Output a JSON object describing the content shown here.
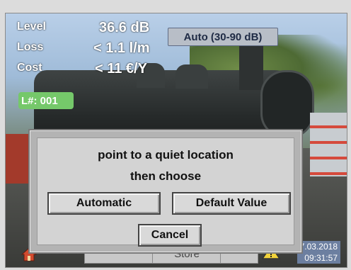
{
  "readings": {
    "level_label": "Level",
    "level_value": "36.6 dB",
    "loss_label": "Loss",
    "loss_value": "< 1.1 l/m",
    "cost_label": "Cost",
    "cost_value": "< 11 €/Y",
    "location_id": "L#: 001"
  },
  "mode_button": "Auto (30-90 dB)",
  "dialog": {
    "line1": "point to a quiet location",
    "line2": "then choose",
    "automatic_label": "Automatic",
    "default_label": "Default Value",
    "cancel_label": "Cancel"
  },
  "bottom_bar": {
    "store_label": "Store",
    "date": "7.03.2018",
    "time": "09:31:57"
  },
  "icons": {
    "home": "home-icon",
    "warning": "warning-icon"
  },
  "colors": {
    "location_badge": "#75c86a",
    "mode_button": "#b8bec7"
  }
}
